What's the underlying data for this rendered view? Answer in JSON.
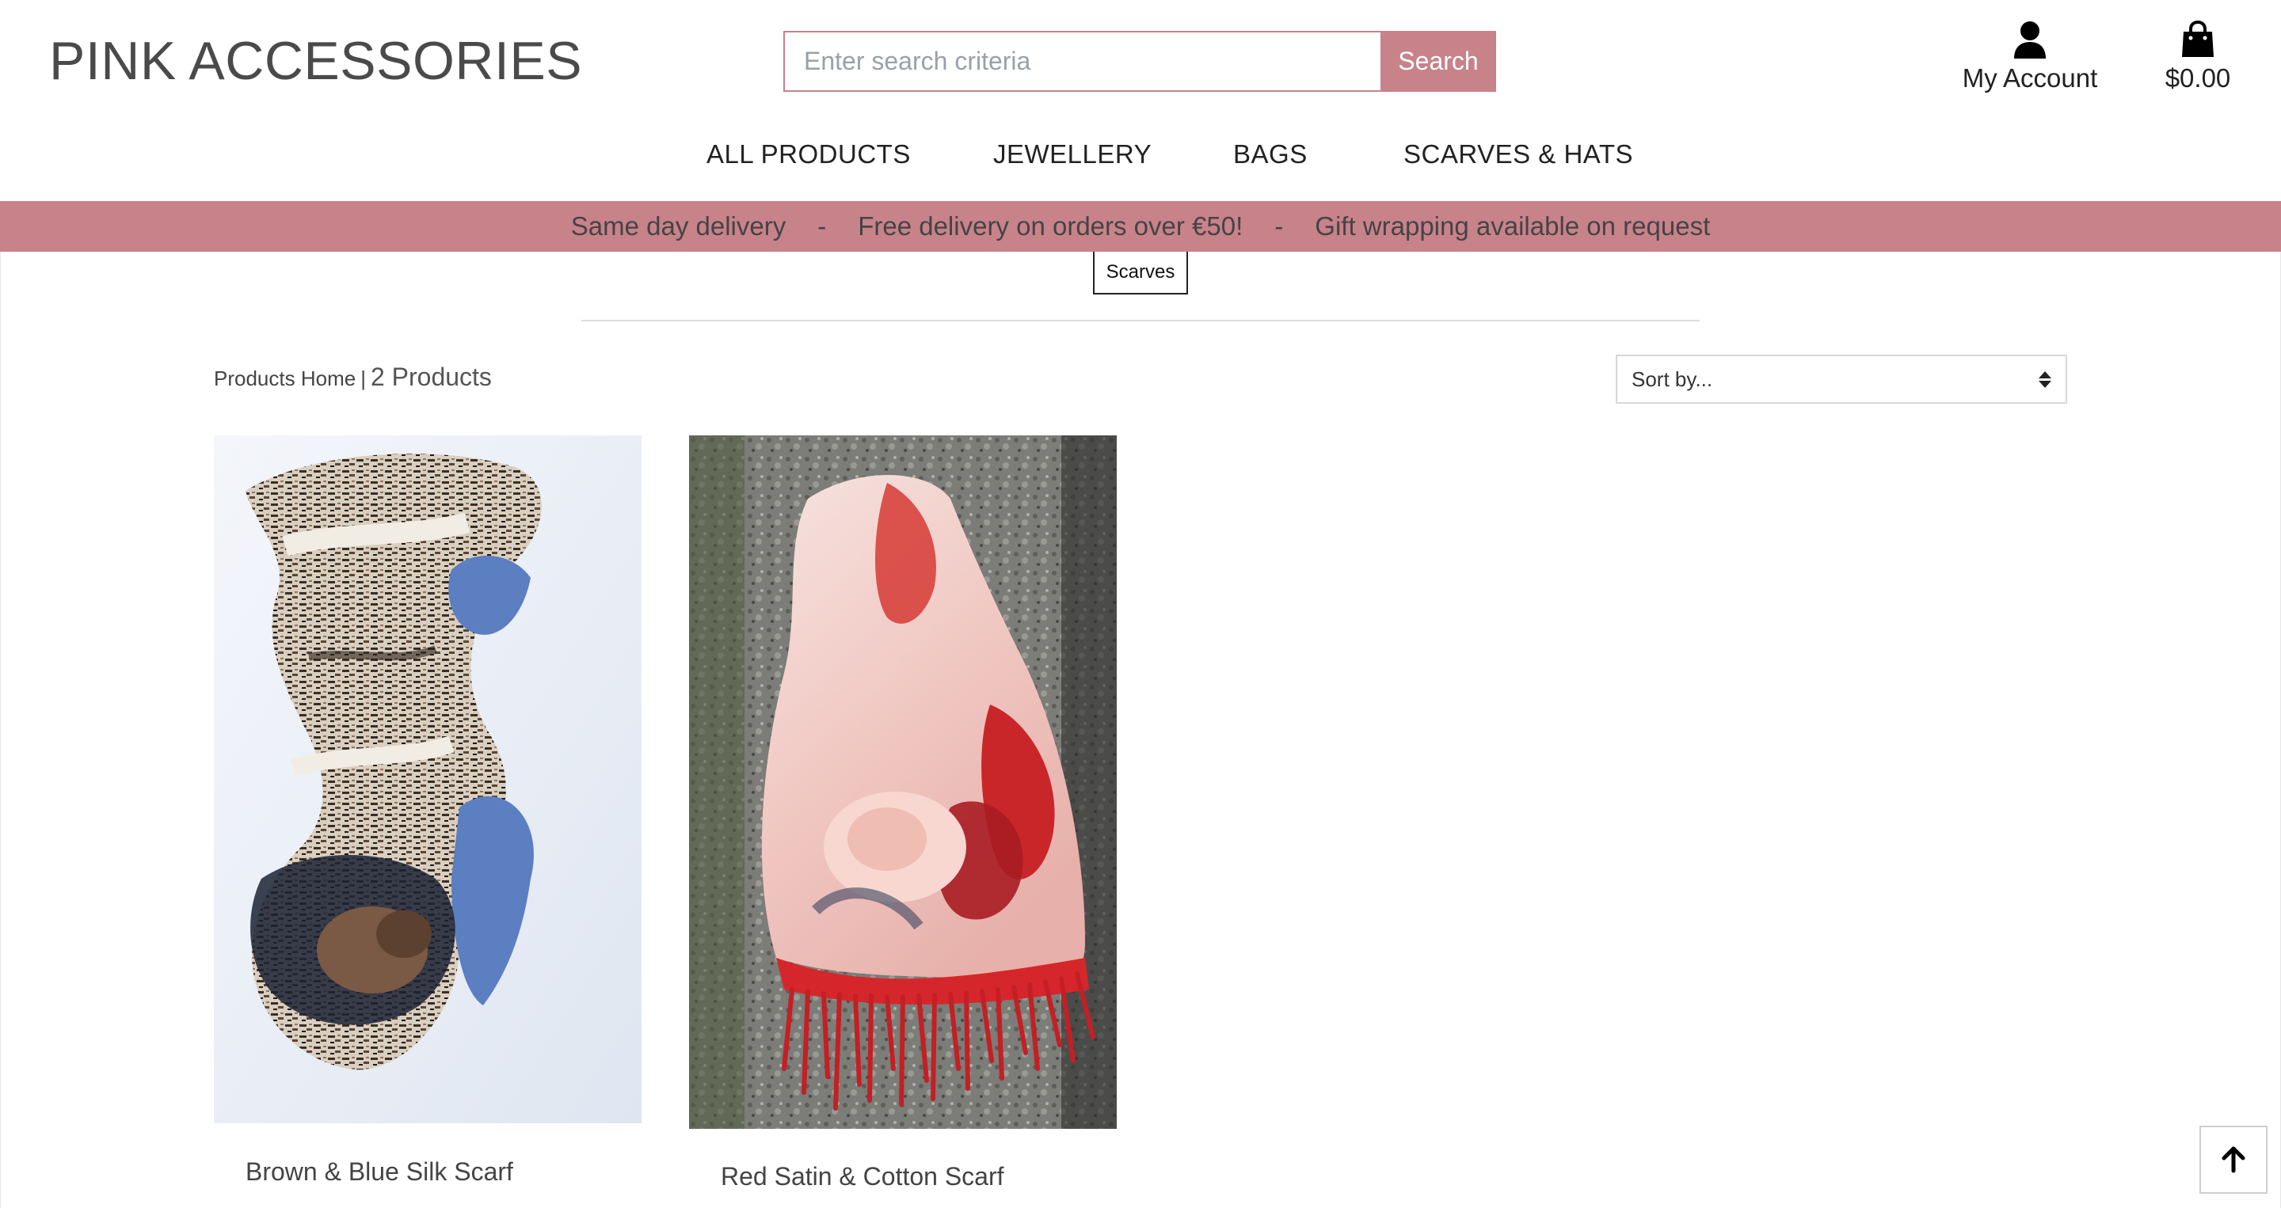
{
  "header": {
    "logo": "PINK ACCESSORIES",
    "search": {
      "placeholder": "Enter search criteria",
      "value": "",
      "button_label": "Search"
    },
    "account_label": "My Account",
    "cart_total": "$0.00",
    "icons": {
      "account": "user-icon",
      "cart": "shopping-bag-icon"
    }
  },
  "nav": {
    "items": [
      {
        "label": "ALL PRODUCTS"
      },
      {
        "label": "JEWELLERY"
      },
      {
        "label": "BAGS"
      },
      {
        "label": "SCARVES & HATS"
      }
    ]
  },
  "banner": {
    "messages": [
      "Same day delivery",
      "Free delivery on orders over €50!",
      "Gift wrapping available on request"
    ],
    "separator": "-"
  },
  "category_filter": {
    "label": "Scarves"
  },
  "toolbar": {
    "breadcrumb_home": "Products Home",
    "separator": "|",
    "product_count": "2 Products",
    "sort_selected": "Sort by..."
  },
  "products": [
    {
      "title": "Brown & Blue Silk Scarf"
    },
    {
      "title": "Red Satin & Cotton Scarf"
    }
  ],
  "back_to_top_icon": "arrow-up-icon",
  "colors": {
    "accent": "#c8828a",
    "text_dark": "#222222",
    "text_muted": "#444444"
  }
}
